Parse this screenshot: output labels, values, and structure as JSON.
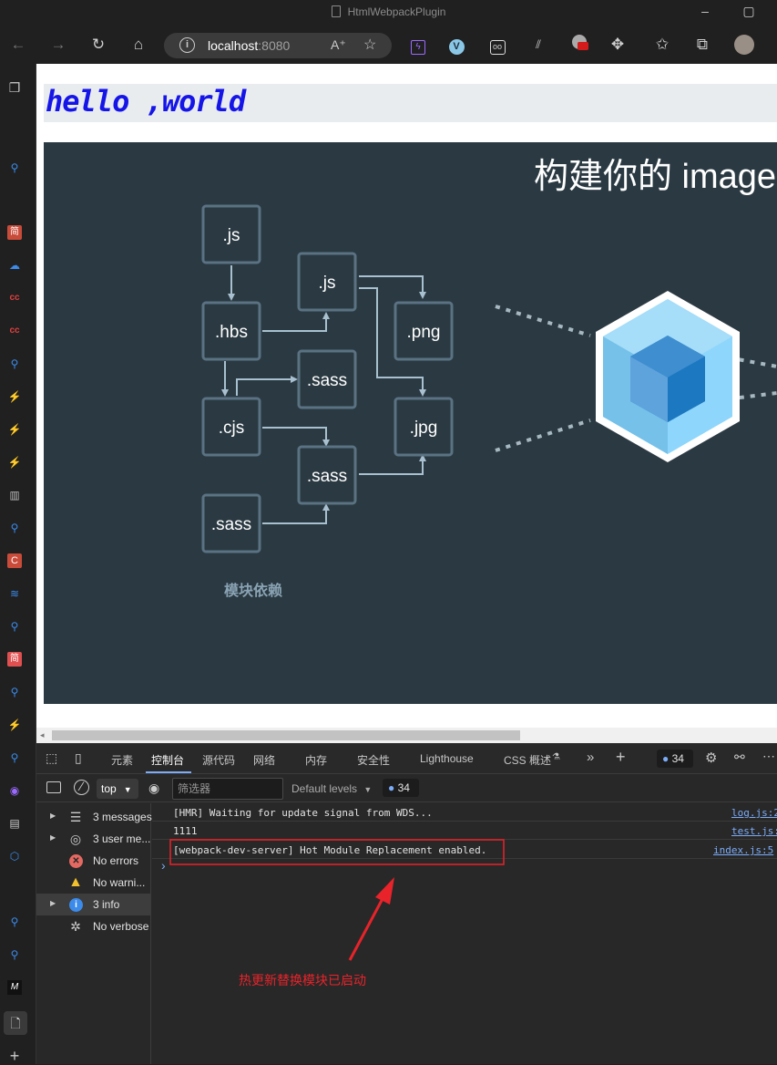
{
  "window": {
    "title": "HtmlWebpackPlugin"
  },
  "address_bar": {
    "host": "localhost",
    "port": ":8080"
  },
  "page": {
    "heading": "hello ,world",
    "banner": {
      "title": "构建你的 image",
      "caption": "模块依赖",
      "modules": [
        ".js",
        ".js",
        ".hbs",
        ".png",
        ".sass",
        ".cjs",
        ".jpg",
        ".sass",
        ".sass"
      ]
    }
  },
  "devtools": {
    "tabs": [
      "元素",
      "控制台",
      "源代码",
      "网络",
      "内存",
      "安全性",
      "Lighthouse",
      "CSS 概述"
    ],
    "active_tab": "控制台",
    "issue_count": "34",
    "context": "top",
    "filter_placeholder": "筛选器",
    "levels": "Default levels",
    "filter_issue_count": "34",
    "sidebar": [
      {
        "label": "3 messages",
        "icon": "list-icon"
      },
      {
        "label": "3 user me...",
        "icon": "user-icon"
      },
      {
        "label": "No errors",
        "icon": "error-icon"
      },
      {
        "label": "No warni...",
        "icon": "warning-icon"
      },
      {
        "label": "3 info",
        "icon": "info-icon"
      },
      {
        "label": "No verbose",
        "icon": "bug-icon"
      }
    ],
    "logs": [
      {
        "message": "[HMR] Waiting for update signal from WDS...",
        "source": "log.js:2"
      },
      {
        "message": "1111",
        "source": "test.js:"
      },
      {
        "message": "[webpack-dev-server] Hot Module Replacement enabled.",
        "source": "index.js:5"
      }
    ],
    "prompt": "›"
  },
  "annotation": {
    "text": "热更新替换模块已启动",
    "color": "#e8232a"
  },
  "colors": {
    "banner_bg": "#2b3a42",
    "module_border": "#5a7283",
    "cube_light": "#8ed6fb",
    "cube_dark": "#1c78c0",
    "link_blue": "#7cacf8",
    "heading_blue": "#1515e8"
  }
}
